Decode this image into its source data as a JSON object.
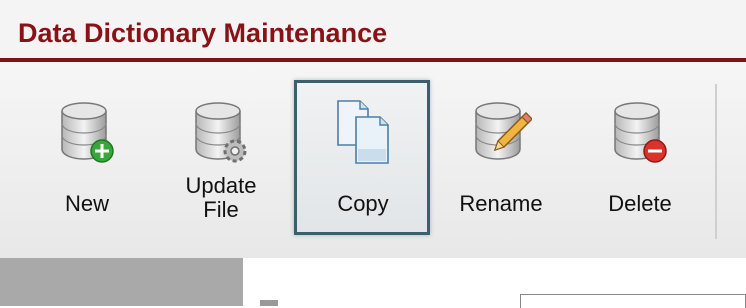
{
  "window": {
    "title": "Data Dictionary Maintenance"
  },
  "toolbar": {
    "buttons": [
      {
        "id": "new",
        "label": "New",
        "icon": "database-add-icon"
      },
      {
        "id": "update",
        "label": "Update\nFile",
        "icon": "database-gear-icon"
      },
      {
        "id": "copy",
        "label": "Copy",
        "icon": "copy-documents-icon",
        "selected": true
      },
      {
        "id": "rename",
        "label": "Rename",
        "icon": "database-pencil-icon"
      },
      {
        "id": "delete",
        "label": "Delete",
        "icon": "database-remove-icon"
      }
    ]
  },
  "colors": {
    "title": "#8a1116",
    "title_rule": "#7a1419",
    "selection_border": "#38606e",
    "add_green": "#3aa53a",
    "delete_red": "#d9342b"
  }
}
